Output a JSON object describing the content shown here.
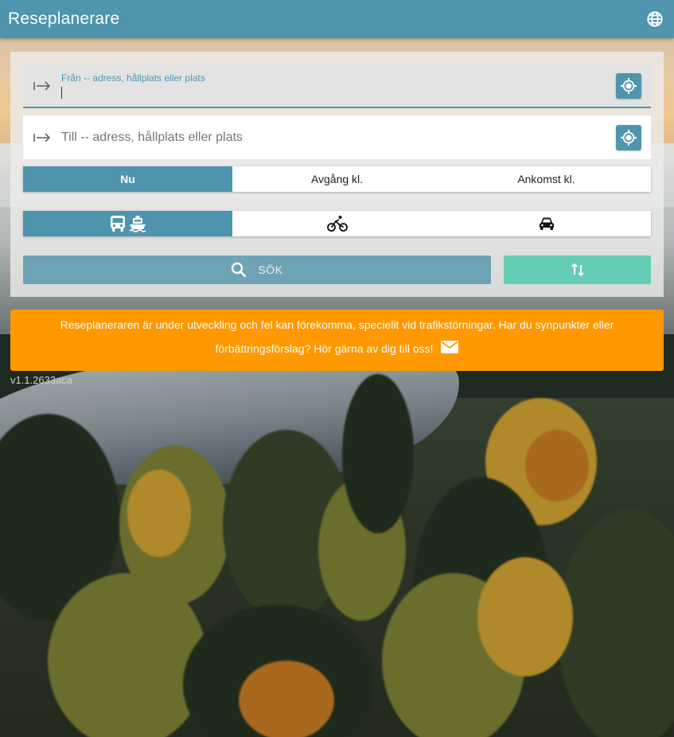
{
  "header": {
    "title": "Reseplanerare"
  },
  "search": {
    "from_label": "Från -- adress, hållplats eller plats",
    "to_placeholder": "Till -- adress, hållplats eller plats"
  },
  "time_options": [
    "Nu",
    "Avgång kl.",
    "Ankomst kl."
  ],
  "selected_time_option": "Nu",
  "travel_modes": [
    "bus-ferry",
    "bicycle",
    "car"
  ],
  "selected_travel_mode": "bus-ferry",
  "actions": {
    "search_label": "SÖK"
  },
  "notice": {
    "text": "Reseplaneraren är under utveckling och fel kan förekomma, specielit vid trafikstörningar. Har du synpunkter eller förbättringsförslag? Hör gärna av dig till oss!"
  },
  "version": "v1.1.2633aca",
  "colors": {
    "primary": "#4e95ad",
    "search_button": "#6ea2b5",
    "swap_button": "#62cdb4",
    "notice": "#ff9801"
  }
}
